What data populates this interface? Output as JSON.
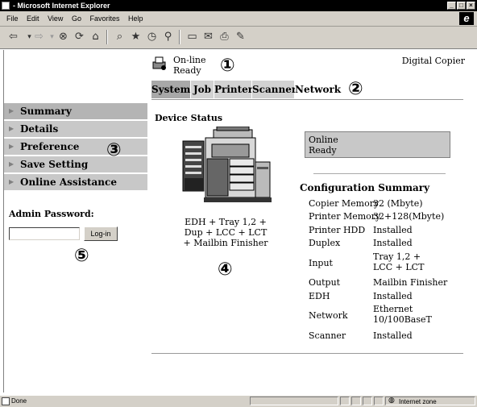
{
  "window": {
    "title": "- Microsoft Internet Explorer",
    "buttons": [
      "_",
      "□",
      "×"
    ]
  },
  "menu": [
    "File",
    "Edit",
    "View",
    "Go",
    "Favorites",
    "Help"
  ],
  "toolbar_icons": [
    "back-icon",
    "forward-icon",
    "stop-icon",
    "refresh-icon",
    "home-icon",
    "search-icon",
    "favorites-icon",
    "history-icon",
    "channels-icon",
    "fullscreen-icon",
    "mail-icon",
    "print-icon",
    "edit-icon"
  ],
  "header": {
    "status_line1": "On-line",
    "status_line2": "Ready",
    "device_name": "Digital Copier"
  },
  "callouts": {
    "c1": "①",
    "c2": "②",
    "c3": "③",
    "c4": "④",
    "c5": "⑤"
  },
  "tabs": [
    "System",
    "Job",
    "Printer",
    "Scanner",
    "Network"
  ],
  "sidebar": {
    "items": [
      "Summary",
      "Details",
      "Preference",
      "Save Setting",
      "Online Assistance"
    ],
    "password_label": "Admin Password:",
    "password_value": "",
    "login_button": "Log-in"
  },
  "main": {
    "section_title": "Device Status",
    "status_box": {
      "line1": "Online",
      "line2": "Ready"
    },
    "options_caption": [
      "EDH + Tray 1,2 +",
      "Dup + LCC + LCT",
      "+ Mailbin Finisher"
    ],
    "config_title": "Configuration Summary",
    "config": [
      {
        "label": "Copier Memory",
        "value": "32 (Mbyte)"
      },
      {
        "label": "Printer Memory",
        "value": "32+128(Mbyte)"
      },
      {
        "label": "Printer HDD",
        "value": "Installed"
      },
      {
        "label": "Duplex",
        "value": "Installed"
      },
      {
        "label": "Input",
        "value": [
          "Tray 1,2 +",
          "LCC + LCT"
        ]
      },
      {
        "label": "Output",
        "value": "Mailbin Finisher"
      },
      {
        "label": "EDH",
        "value": "Installed"
      },
      {
        "label": "Network",
        "value": [
          "Ethernet",
          "10/100BaseT"
        ]
      },
      {
        "label": "Scanner",
        "value": "Installed"
      }
    ]
  },
  "statusbar": {
    "left": "Done",
    "zone": "Internet zone"
  }
}
